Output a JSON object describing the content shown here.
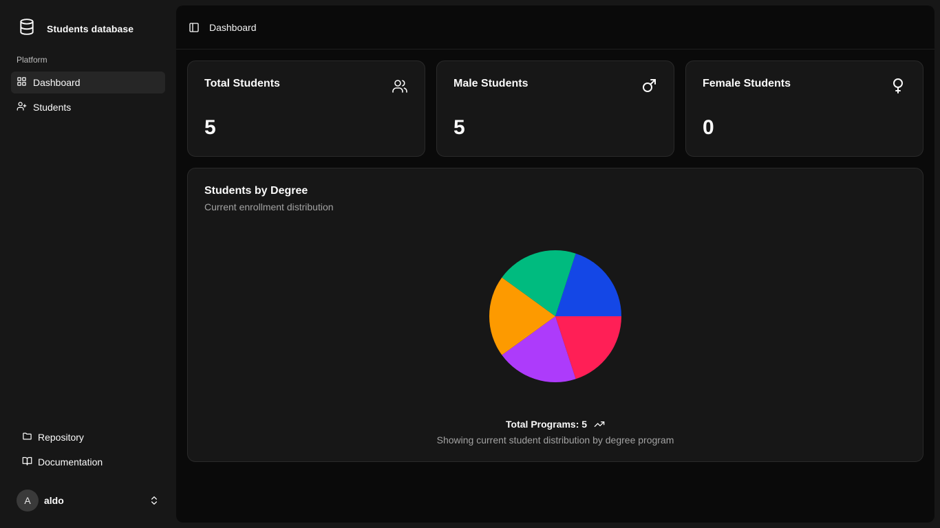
{
  "sidebar": {
    "brand": {
      "name": "Students database",
      "icon": "database-icon"
    },
    "section_label": "Platform",
    "nav": [
      {
        "label": "Dashboard",
        "icon": "grid-icon",
        "active": true
      },
      {
        "label": "Students",
        "icon": "user-plus-icon",
        "active": false
      }
    ],
    "bottom_nav": [
      {
        "label": "Repository",
        "icon": "folder-icon"
      },
      {
        "label": "Documentation",
        "icon": "book-icon"
      }
    ],
    "user": {
      "avatar_initial": "A",
      "name": "aldo"
    }
  },
  "header": {
    "title": "Dashboard"
  },
  "stats": [
    {
      "title": "Total Students",
      "value": "5",
      "icon": "users-icon"
    },
    {
      "title": "Male Students",
      "value": "5",
      "icon": "male-icon"
    },
    {
      "title": "Female Students",
      "value": "0",
      "icon": "female-icon"
    }
  ],
  "chart": {
    "title": "Students by Degree",
    "subtitle": "Current enrollment distribution",
    "footer_total": "Total Programs: 5",
    "footer_note": "Showing current student distribution by degree program"
  },
  "colors": {
    "blue": "#1447e6",
    "red": "#ff1f56",
    "purple": "#ad3bfb",
    "orange": "#fd9a00",
    "green": "#00bb7f"
  },
  "chart_data": {
    "type": "pie",
    "values": [
      1,
      1,
      1,
      1,
      1
    ],
    "colors": [
      "#1447e6",
      "#ff1f56",
      "#ad3bfb",
      "#fd9a00",
      "#00bb7f"
    ]
  }
}
